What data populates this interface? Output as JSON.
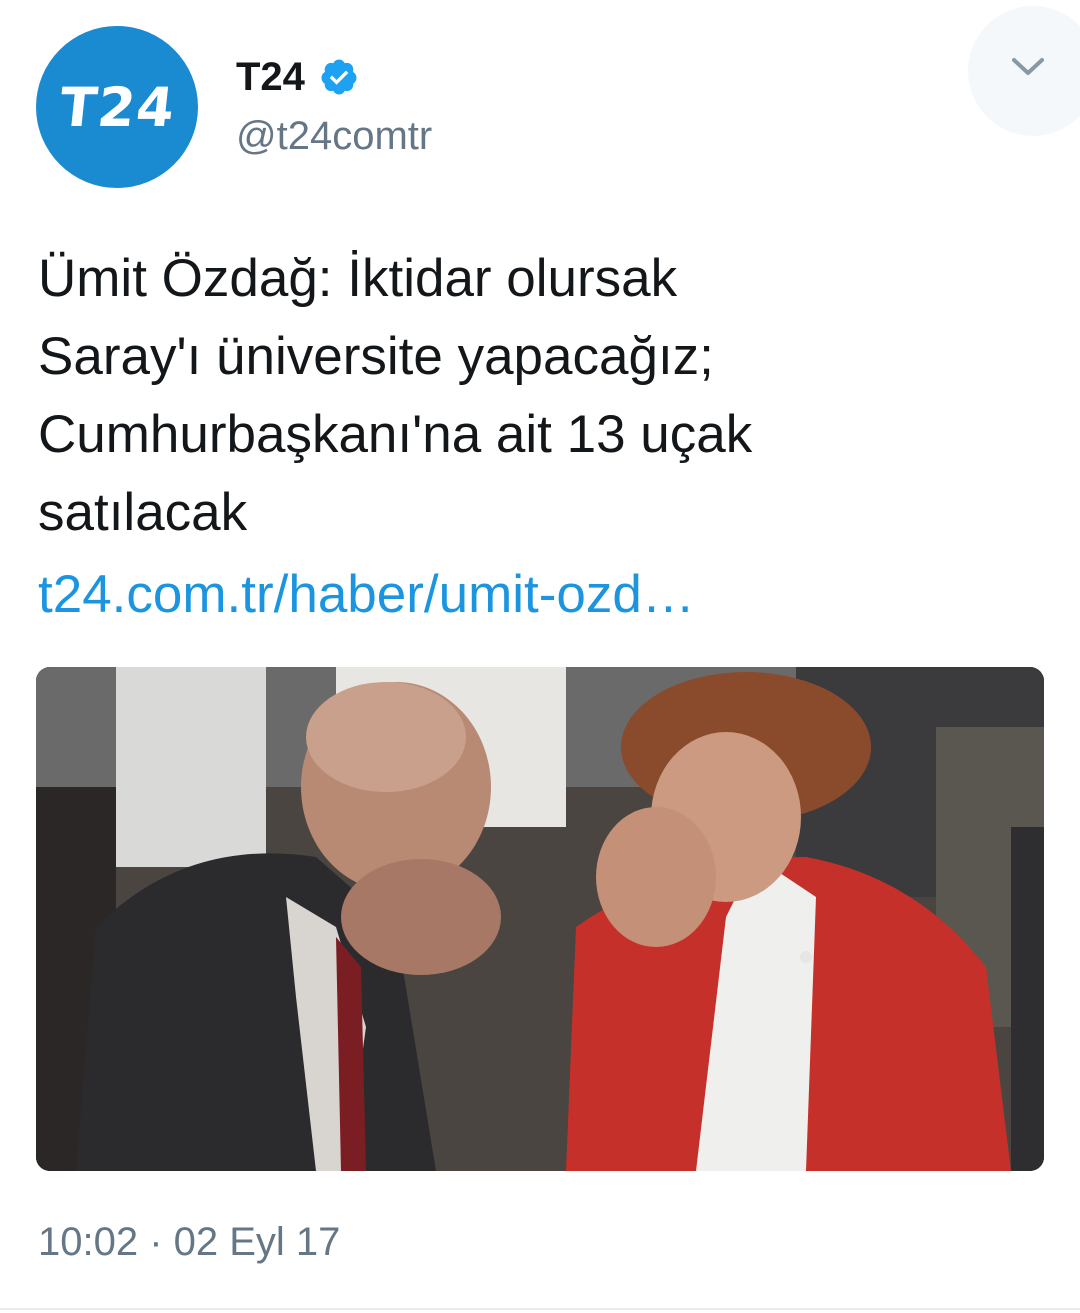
{
  "account": {
    "avatar_text": "T24",
    "name": "T24",
    "verified": true,
    "handle": "@t24comtr"
  },
  "tweet": {
    "text_lines": [
      "Ümit Özdağ: İktidar olursak",
      "Saray'ı üniversite yapacağız;",
      "Cumhurbaşkanı'na ait 13 uçak",
      "satılacak"
    ],
    "link": "t24.com.tr/haber/umit-ozd…",
    "timestamp": "10:02 · 02 Eyl 17"
  },
  "colors": {
    "avatar_bg": "#1a8ad1",
    "link": "#1b95e0",
    "secondary_text": "#657786",
    "verified_badge": "#1da1f2"
  },
  "icons": {
    "caret": "chevron-down-icon",
    "verified": "verified-badge-icon"
  }
}
